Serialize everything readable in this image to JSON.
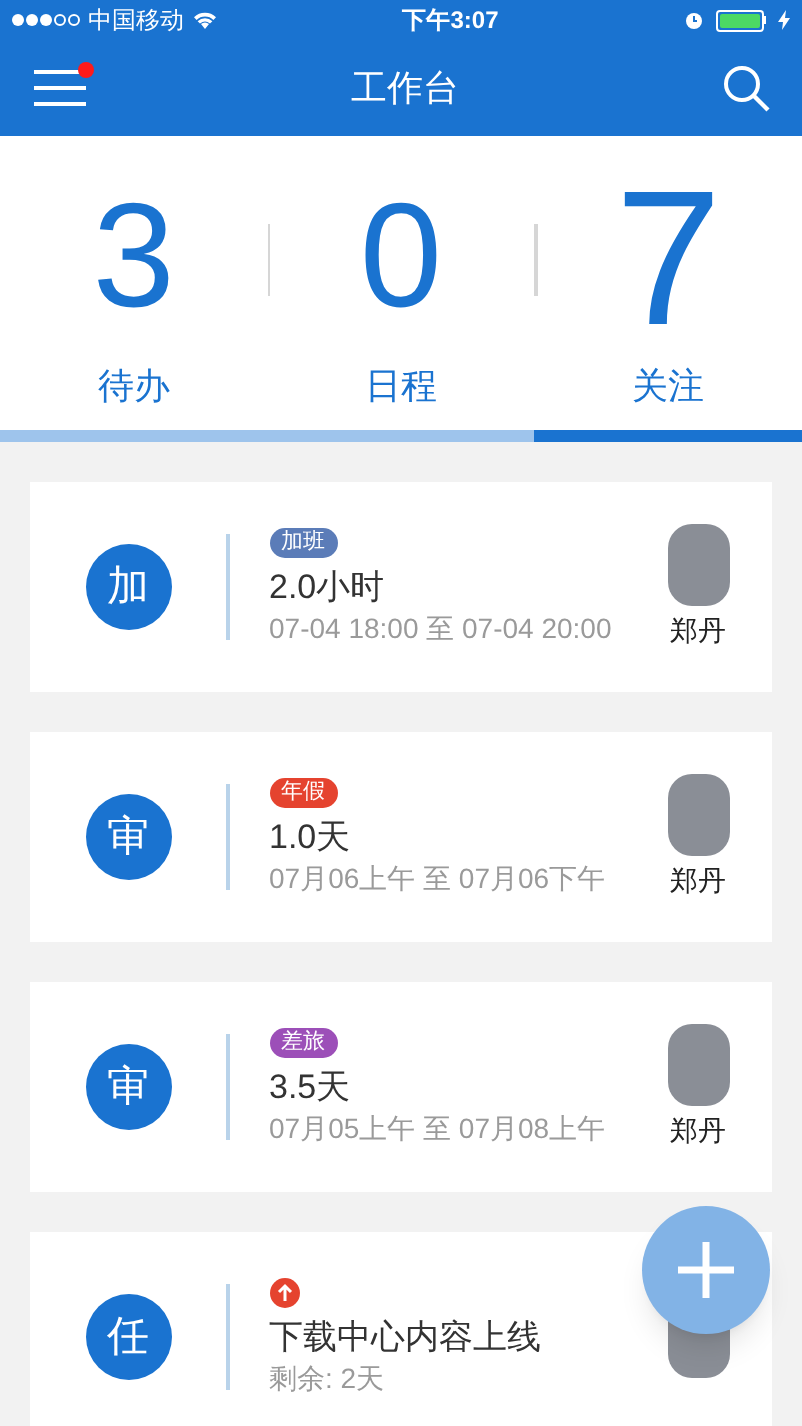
{
  "status_bar": {
    "signal_dots": [
      {
        "filled": true
      },
      {
        "filled": true
      },
      {
        "filled": true
      },
      {
        "filled": false
      },
      {
        "filled": false
      }
    ],
    "carrier": "中国移动",
    "time": "下午3:07",
    "battery": {
      "level": 1,
      "charging": true
    }
  },
  "nav": {
    "title": "工作台",
    "menu_badge": true
  },
  "stats": [
    {
      "count": "3",
      "label": "待办",
      "selected": false
    },
    {
      "count": "0",
      "label": "日程",
      "selected": false
    },
    {
      "count": "7",
      "label": "关注",
      "selected": true
    }
  ],
  "cards": [
    {
      "avatar_letter": "加",
      "tag": {
        "kind": "label",
        "label": "加班",
        "color": "#5b7cb8"
      },
      "title": "2.0小时",
      "subtitle": "07-04 18:00 至 07-04 20:00",
      "person": "郑丹"
    },
    {
      "avatar_letter": "审",
      "tag": {
        "kind": "label",
        "label": "年假",
        "color": "#e5432f"
      },
      "title": "1.0天",
      "subtitle": "07月06上午 至 07月06下午",
      "person": "郑丹"
    },
    {
      "avatar_letter": "审",
      "tag": {
        "kind": "label",
        "label": "差旅",
        "color": "#9c4fb8"
      },
      "title": "3.5天",
      "subtitle": "07月05上午 至 07月08上午",
      "person": "郑丹"
    },
    {
      "avatar_letter": "任",
      "tag": {
        "kind": "priority",
        "color": "#e5432f"
      },
      "title": "下载中心内容上线",
      "subtitle": "剩余: 2天"
    }
  ]
}
